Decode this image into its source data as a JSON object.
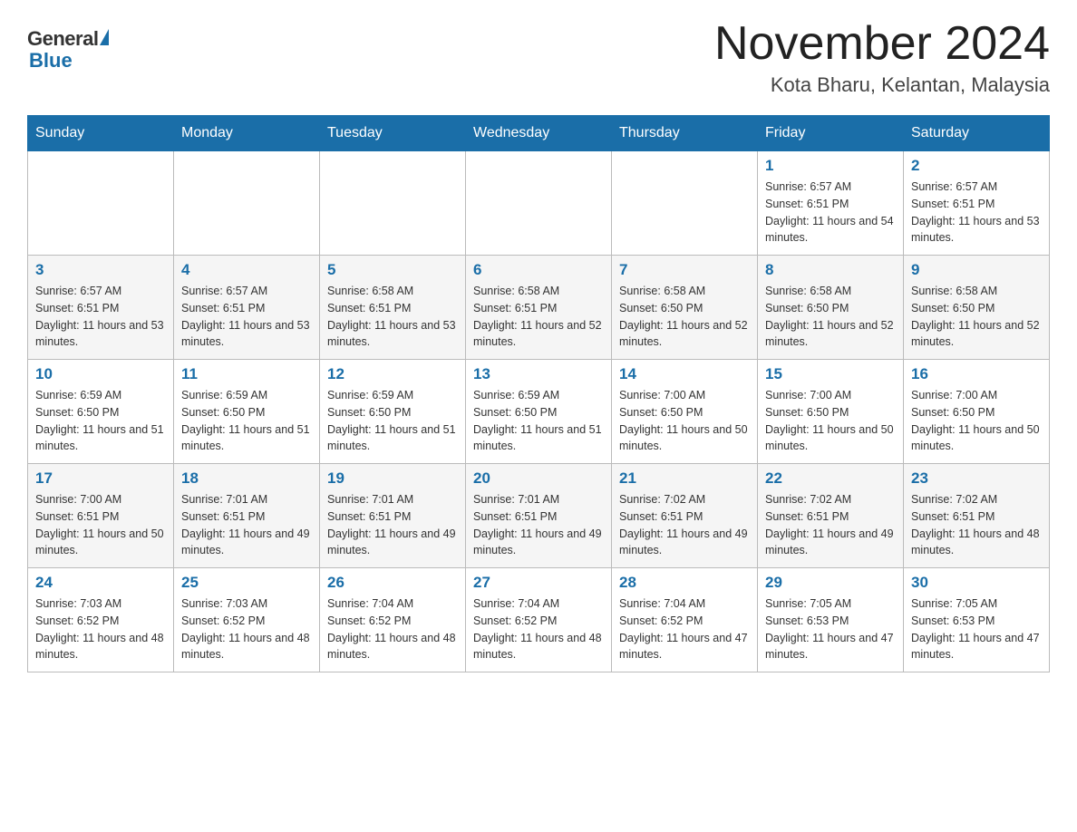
{
  "header": {
    "logo_general": "General",
    "logo_blue": "Blue",
    "month_title": "November 2024",
    "location": "Kota Bharu, Kelantan, Malaysia"
  },
  "days_of_week": [
    "Sunday",
    "Monday",
    "Tuesday",
    "Wednesday",
    "Thursday",
    "Friday",
    "Saturday"
  ],
  "weeks": [
    [
      {
        "day": "",
        "sunrise": "",
        "sunset": "",
        "daylight": ""
      },
      {
        "day": "",
        "sunrise": "",
        "sunset": "",
        "daylight": ""
      },
      {
        "day": "",
        "sunrise": "",
        "sunset": "",
        "daylight": ""
      },
      {
        "day": "",
        "sunrise": "",
        "sunset": "",
        "daylight": ""
      },
      {
        "day": "",
        "sunrise": "",
        "sunset": "",
        "daylight": ""
      },
      {
        "day": "1",
        "sunrise": "Sunrise: 6:57 AM",
        "sunset": "Sunset: 6:51 PM",
        "daylight": "Daylight: 11 hours and 54 minutes."
      },
      {
        "day": "2",
        "sunrise": "Sunrise: 6:57 AM",
        "sunset": "Sunset: 6:51 PM",
        "daylight": "Daylight: 11 hours and 53 minutes."
      }
    ],
    [
      {
        "day": "3",
        "sunrise": "Sunrise: 6:57 AM",
        "sunset": "Sunset: 6:51 PM",
        "daylight": "Daylight: 11 hours and 53 minutes."
      },
      {
        "day": "4",
        "sunrise": "Sunrise: 6:57 AM",
        "sunset": "Sunset: 6:51 PM",
        "daylight": "Daylight: 11 hours and 53 minutes."
      },
      {
        "day": "5",
        "sunrise": "Sunrise: 6:58 AM",
        "sunset": "Sunset: 6:51 PM",
        "daylight": "Daylight: 11 hours and 53 minutes."
      },
      {
        "day": "6",
        "sunrise": "Sunrise: 6:58 AM",
        "sunset": "Sunset: 6:51 PM",
        "daylight": "Daylight: 11 hours and 52 minutes."
      },
      {
        "day": "7",
        "sunrise": "Sunrise: 6:58 AM",
        "sunset": "Sunset: 6:50 PM",
        "daylight": "Daylight: 11 hours and 52 minutes."
      },
      {
        "day": "8",
        "sunrise": "Sunrise: 6:58 AM",
        "sunset": "Sunset: 6:50 PM",
        "daylight": "Daylight: 11 hours and 52 minutes."
      },
      {
        "day": "9",
        "sunrise": "Sunrise: 6:58 AM",
        "sunset": "Sunset: 6:50 PM",
        "daylight": "Daylight: 11 hours and 52 minutes."
      }
    ],
    [
      {
        "day": "10",
        "sunrise": "Sunrise: 6:59 AM",
        "sunset": "Sunset: 6:50 PM",
        "daylight": "Daylight: 11 hours and 51 minutes."
      },
      {
        "day": "11",
        "sunrise": "Sunrise: 6:59 AM",
        "sunset": "Sunset: 6:50 PM",
        "daylight": "Daylight: 11 hours and 51 minutes."
      },
      {
        "day": "12",
        "sunrise": "Sunrise: 6:59 AM",
        "sunset": "Sunset: 6:50 PM",
        "daylight": "Daylight: 11 hours and 51 minutes."
      },
      {
        "day": "13",
        "sunrise": "Sunrise: 6:59 AM",
        "sunset": "Sunset: 6:50 PM",
        "daylight": "Daylight: 11 hours and 51 minutes."
      },
      {
        "day": "14",
        "sunrise": "Sunrise: 7:00 AM",
        "sunset": "Sunset: 6:50 PM",
        "daylight": "Daylight: 11 hours and 50 minutes."
      },
      {
        "day": "15",
        "sunrise": "Sunrise: 7:00 AM",
        "sunset": "Sunset: 6:50 PM",
        "daylight": "Daylight: 11 hours and 50 minutes."
      },
      {
        "day": "16",
        "sunrise": "Sunrise: 7:00 AM",
        "sunset": "Sunset: 6:50 PM",
        "daylight": "Daylight: 11 hours and 50 minutes."
      }
    ],
    [
      {
        "day": "17",
        "sunrise": "Sunrise: 7:00 AM",
        "sunset": "Sunset: 6:51 PM",
        "daylight": "Daylight: 11 hours and 50 minutes."
      },
      {
        "day": "18",
        "sunrise": "Sunrise: 7:01 AM",
        "sunset": "Sunset: 6:51 PM",
        "daylight": "Daylight: 11 hours and 49 minutes."
      },
      {
        "day": "19",
        "sunrise": "Sunrise: 7:01 AM",
        "sunset": "Sunset: 6:51 PM",
        "daylight": "Daylight: 11 hours and 49 minutes."
      },
      {
        "day": "20",
        "sunrise": "Sunrise: 7:01 AM",
        "sunset": "Sunset: 6:51 PM",
        "daylight": "Daylight: 11 hours and 49 minutes."
      },
      {
        "day": "21",
        "sunrise": "Sunrise: 7:02 AM",
        "sunset": "Sunset: 6:51 PM",
        "daylight": "Daylight: 11 hours and 49 minutes."
      },
      {
        "day": "22",
        "sunrise": "Sunrise: 7:02 AM",
        "sunset": "Sunset: 6:51 PM",
        "daylight": "Daylight: 11 hours and 49 minutes."
      },
      {
        "day": "23",
        "sunrise": "Sunrise: 7:02 AM",
        "sunset": "Sunset: 6:51 PM",
        "daylight": "Daylight: 11 hours and 48 minutes."
      }
    ],
    [
      {
        "day": "24",
        "sunrise": "Sunrise: 7:03 AM",
        "sunset": "Sunset: 6:52 PM",
        "daylight": "Daylight: 11 hours and 48 minutes."
      },
      {
        "day": "25",
        "sunrise": "Sunrise: 7:03 AM",
        "sunset": "Sunset: 6:52 PM",
        "daylight": "Daylight: 11 hours and 48 minutes."
      },
      {
        "day": "26",
        "sunrise": "Sunrise: 7:04 AM",
        "sunset": "Sunset: 6:52 PM",
        "daylight": "Daylight: 11 hours and 48 minutes."
      },
      {
        "day": "27",
        "sunrise": "Sunrise: 7:04 AM",
        "sunset": "Sunset: 6:52 PM",
        "daylight": "Daylight: 11 hours and 48 minutes."
      },
      {
        "day": "28",
        "sunrise": "Sunrise: 7:04 AM",
        "sunset": "Sunset: 6:52 PM",
        "daylight": "Daylight: 11 hours and 47 minutes."
      },
      {
        "day": "29",
        "sunrise": "Sunrise: 7:05 AM",
        "sunset": "Sunset: 6:53 PM",
        "daylight": "Daylight: 11 hours and 47 minutes."
      },
      {
        "day": "30",
        "sunrise": "Sunrise: 7:05 AM",
        "sunset": "Sunset: 6:53 PM",
        "daylight": "Daylight: 11 hours and 47 minutes."
      }
    ]
  ]
}
